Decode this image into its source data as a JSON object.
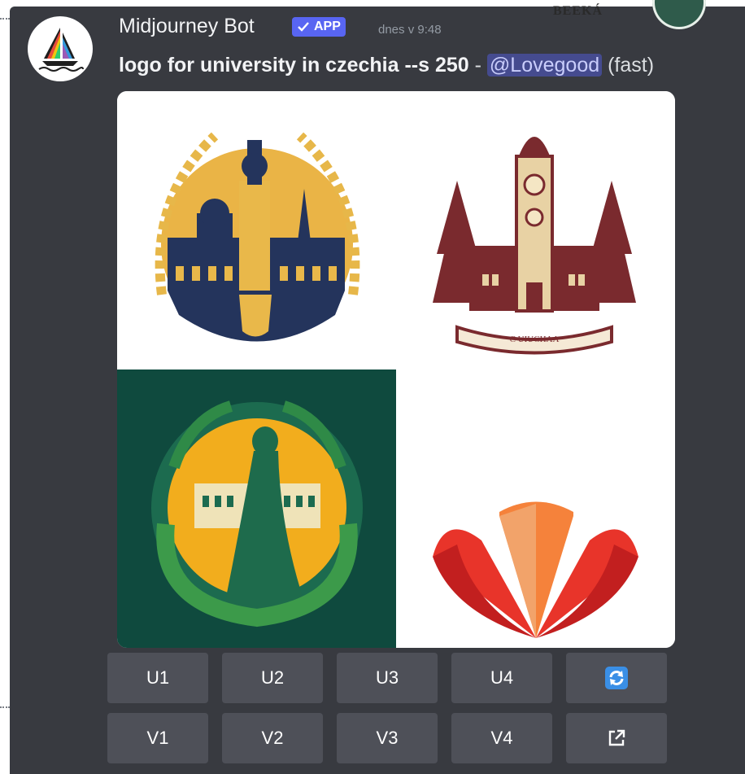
{
  "message": {
    "author": "Midjourney Bot",
    "app_tag": "APP",
    "timestamp": "dnes v 9:48",
    "prompt": "logo for university in czechia --s 250",
    "separator": "-",
    "mention": "@Lovegood",
    "mode": "(fast)"
  },
  "images": {
    "tile2_banner": "C UIUCHAA"
  },
  "buttons": {
    "upscale": [
      "U1",
      "U2",
      "U3",
      "U4"
    ],
    "variation": [
      "V1",
      "V2",
      "V3",
      "V4"
    ],
    "reroll_icon": "refresh-icon",
    "open_icon": "external-link-icon"
  },
  "corner_text": "BEEKÁ",
  "colors": {
    "background": "#383a40",
    "button": "#4e5058",
    "app_tag": "#5865f2",
    "mention": "#454b8f",
    "reroll": "#3a8fe6"
  }
}
